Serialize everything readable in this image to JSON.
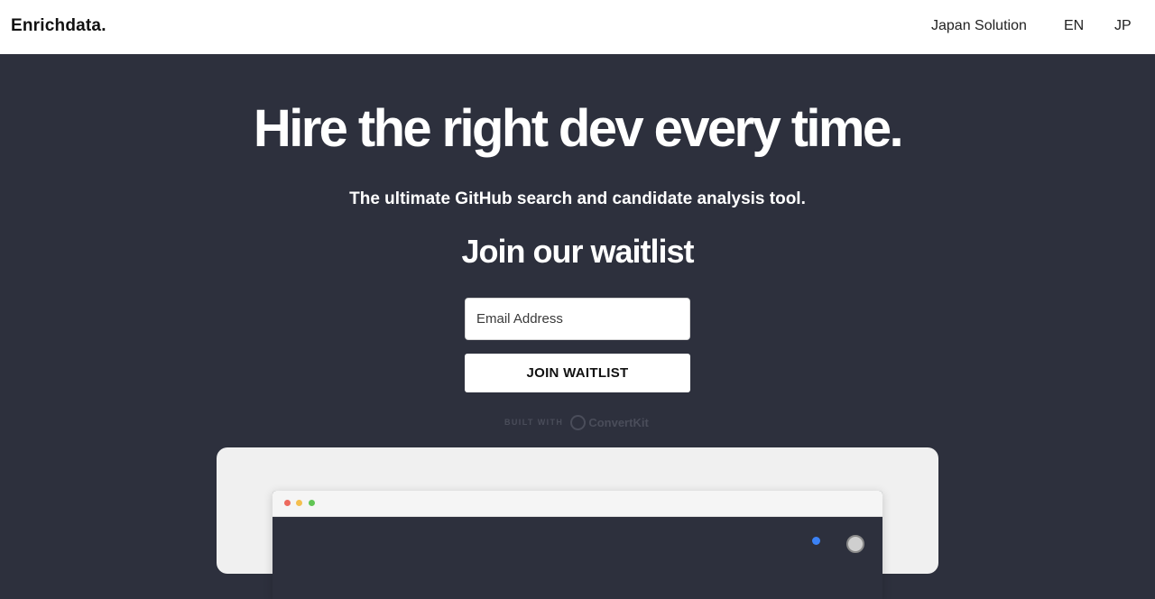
{
  "header": {
    "brand": "Enrichdata.",
    "nav": {
      "japan_solution": "Japan Solution",
      "en": "EN",
      "jp": "JP"
    }
  },
  "hero": {
    "title": "Hire the right dev every time.",
    "subtitle": "The ultimate GitHub search and candidate analysis tool.",
    "waitlist_heading": "Join our waitlist"
  },
  "form": {
    "email_placeholder": "Email Address",
    "email_value": "",
    "submit_label": "JOIN WAITLIST"
  },
  "footer_badge": {
    "built_with": "BUILT WITH",
    "provider": "ConvertKit"
  },
  "colors": {
    "page_background": "#2d303d",
    "header_background": "#ffffff",
    "preview_card": "#f0f0f0"
  }
}
